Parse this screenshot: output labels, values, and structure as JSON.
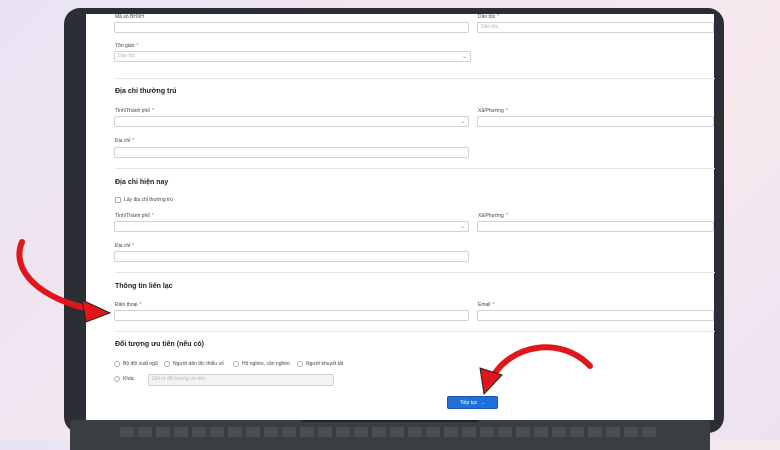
{
  "form": {
    "row0": {
      "left_label": "Mã số BHXH",
      "right_label": "Dân tộc",
      "right_placeholder": "Dân tộc"
    },
    "religion": {
      "label": "Tôn giáo",
      "placeholder": "Dân tộc"
    },
    "permanent": {
      "title": "Địa chỉ thường trú",
      "province_label": "Tỉnh/Thành phố",
      "ward_label": "Xã/Phường",
      "address_label": "Địa chỉ"
    },
    "current": {
      "title": "Địa chỉ hiện nay",
      "same_checkbox": "Lấy địa chỉ thường trú",
      "province_label": "Tỉnh/Thành phố",
      "ward_label": "Xã/Phường",
      "address_label": "Địa chỉ"
    },
    "contact": {
      "title": "Thông tin liên lạc",
      "phone_label": "Điện thoại",
      "email_label": "Email"
    },
    "priority": {
      "title": "Đối tượng ưu tiên (nếu có)",
      "options": [
        "Bộ đội xuất ngũ",
        "Người dân tộc thiểu số",
        "Hộ nghèo, cận nghèo",
        "Người khuyết tật"
      ],
      "other_label": "Khác",
      "other_placeholder": "Ghi rõ đối tượng ưu tiên"
    },
    "submit_label": "Tiếp tục",
    "submit_arrow": "→",
    "required_mark": "*",
    "chevron": "⌄"
  },
  "colors": {
    "accent": "#1f6fd6",
    "arrow": "#e0161b"
  }
}
